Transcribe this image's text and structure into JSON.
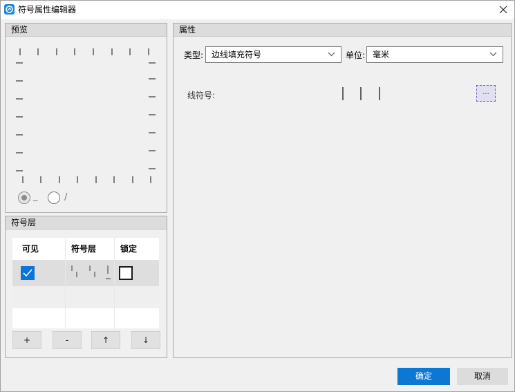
{
  "window": {
    "title": "符号属性编辑器"
  },
  "preview": {
    "title": "预览",
    "radio_options": [
      "_",
      "/"
    ],
    "selected_radio": 0
  },
  "layers": {
    "title": "符号层",
    "columns": [
      "可见",
      "符号层",
      "锁定"
    ],
    "rows": [
      {
        "visible": true,
        "locked": false
      }
    ],
    "buttons": {
      "add": "+",
      "remove": "-",
      "up": "↑",
      "down": "↓"
    }
  },
  "properties": {
    "title": "属性",
    "type_label": "类型:",
    "type_value": "边线填充符号",
    "unit_label": "单位:",
    "unit_value": "毫米",
    "line_symbol_label": "线符号:",
    "ellipsis": "..."
  },
  "footer": {
    "ok": "确定",
    "cancel": "取消"
  },
  "colors": {
    "accent": "#0c78d4",
    "app_icon": "#1e8ad6"
  }
}
